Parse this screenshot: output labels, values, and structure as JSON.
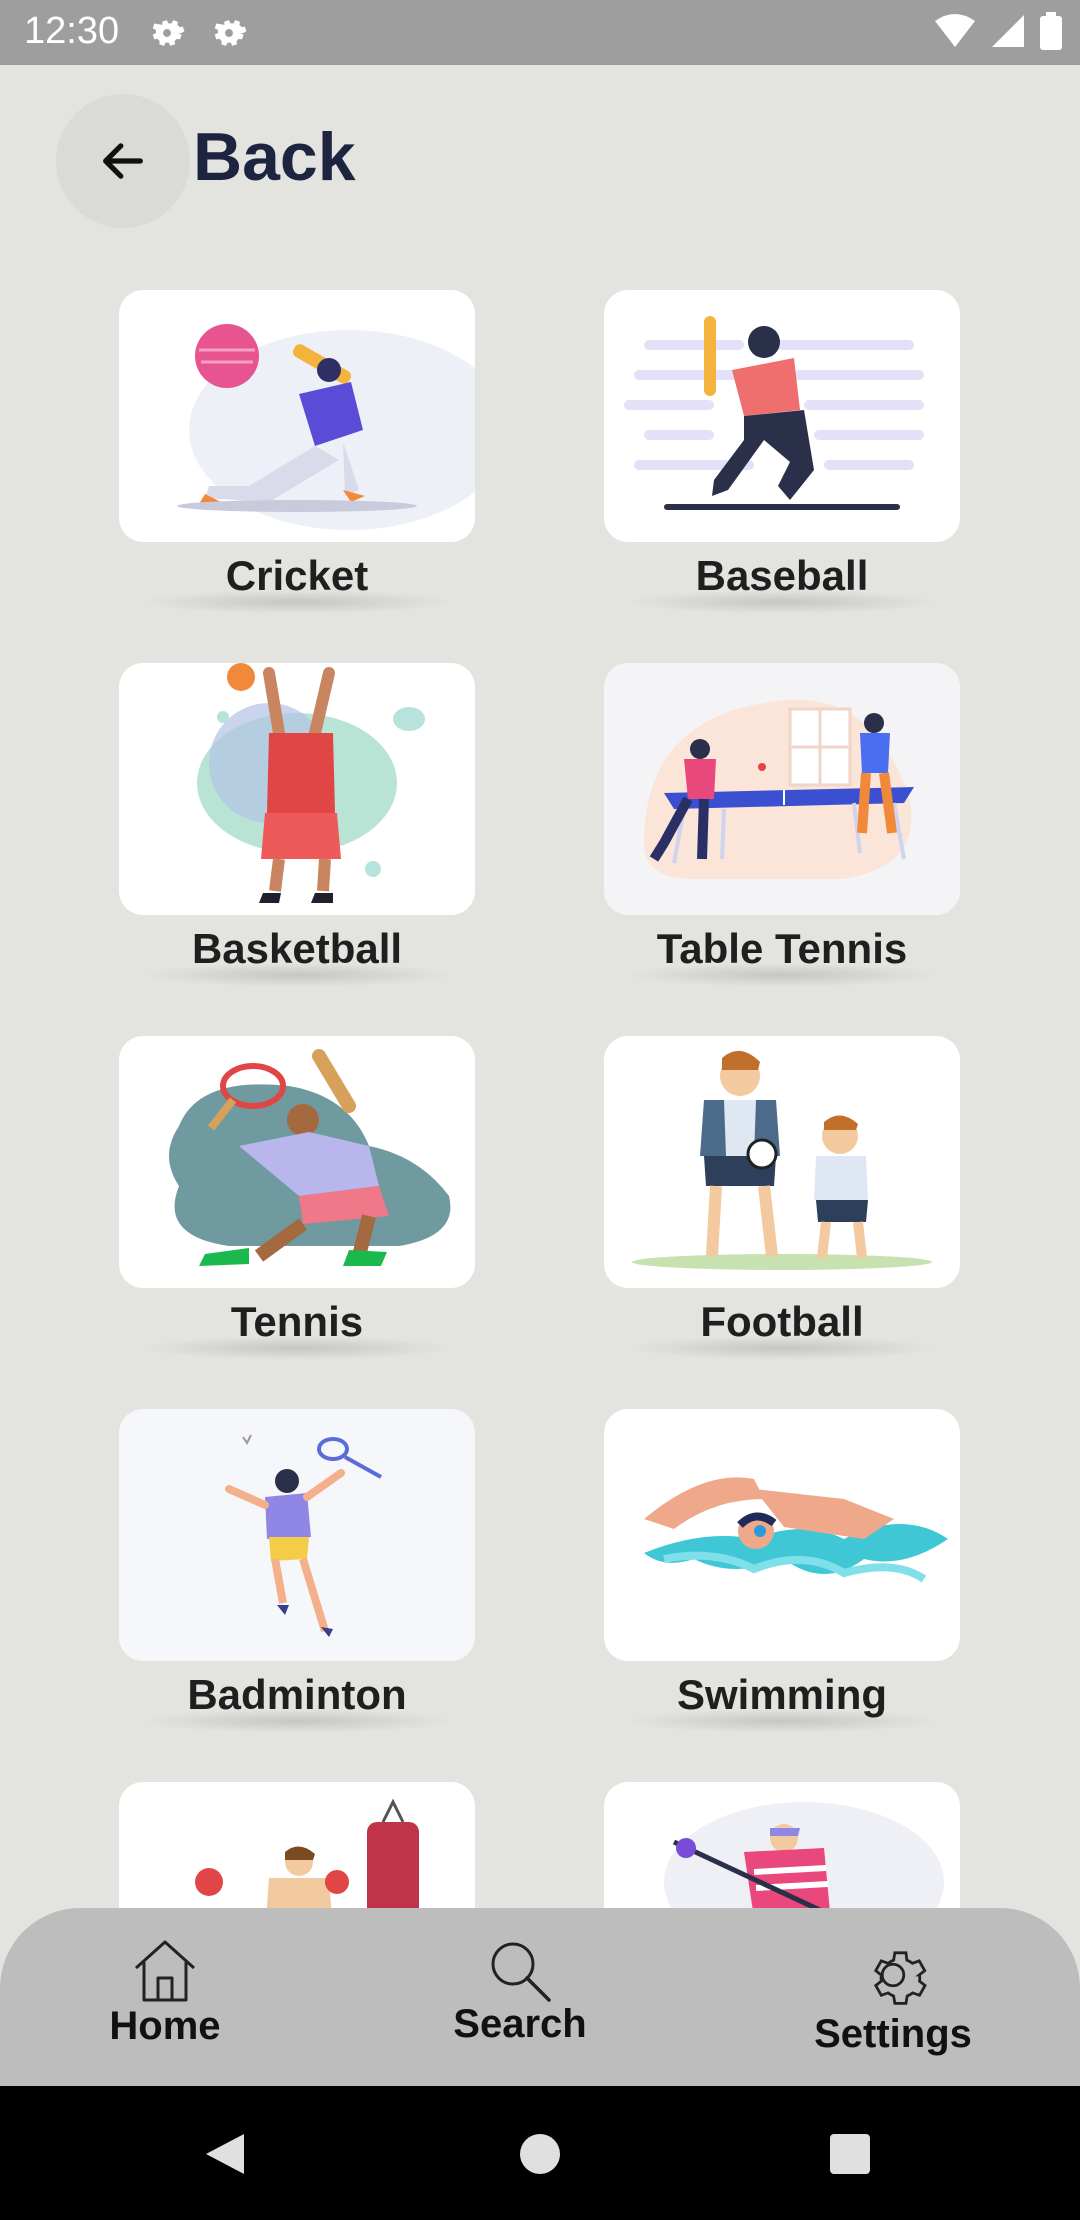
{
  "status_bar": {
    "time": "12:30"
  },
  "header": {
    "back_label": "Back"
  },
  "sports": [
    {
      "label": "Cricket"
    },
    {
      "label": "Baseball"
    },
    {
      "label": "Basketball"
    },
    {
      "label": "Table Tennis"
    },
    {
      "label": "Tennis"
    },
    {
      "label": "Football"
    },
    {
      "label": "Badminton"
    },
    {
      "label": "Swimming"
    }
  ],
  "bottom_nav": {
    "home": "Home",
    "search": "Search",
    "settings": "Settings"
  },
  "colors": {
    "background": "#e3e3e0",
    "title": "#1c2440",
    "nav": "#bdbdbd",
    "status_bar": "#9e9e9e"
  }
}
